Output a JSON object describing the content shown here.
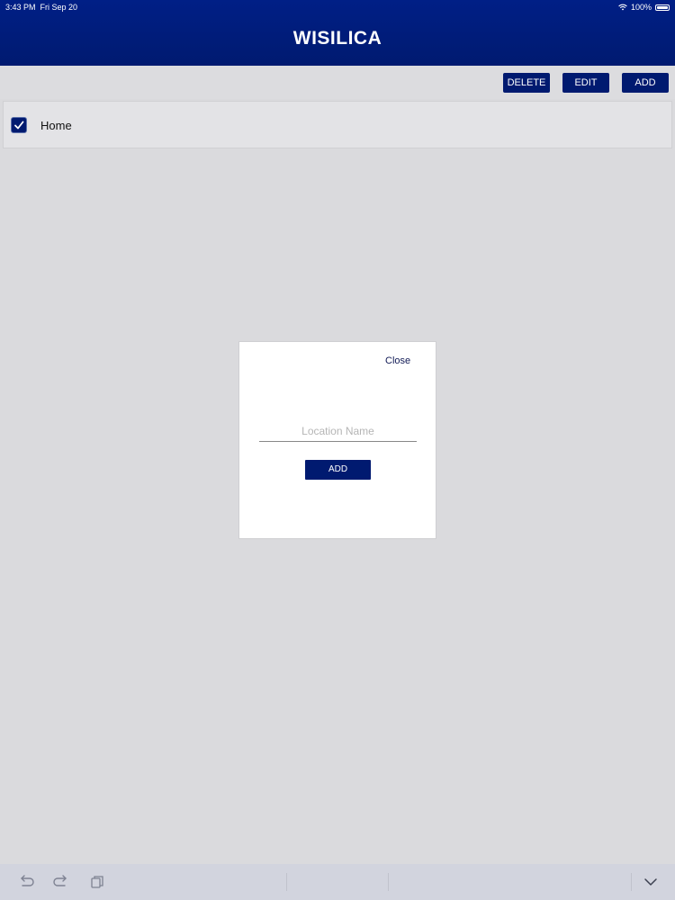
{
  "status_bar": {
    "time": "3:43 PM",
    "date": "Fri Sep 20",
    "battery": "100%"
  },
  "header": {
    "title": "WISILICA"
  },
  "toolbar": {
    "delete_label": "DELETE",
    "edit_label": "EDIT",
    "add_label": "ADD"
  },
  "locations": {
    "items": [
      {
        "label": "Home",
        "checked": true
      }
    ]
  },
  "dialog": {
    "close_label": "Close",
    "input_placeholder": "Location Name",
    "input_value": "",
    "add_label": "ADD"
  },
  "bottom_bar": {
    "icons": [
      "undo-icon",
      "redo-icon",
      "copy-icon",
      "chevron-down-icon"
    ]
  },
  "colors": {
    "brand_navy": "#001a70",
    "background": "#dadadd"
  }
}
